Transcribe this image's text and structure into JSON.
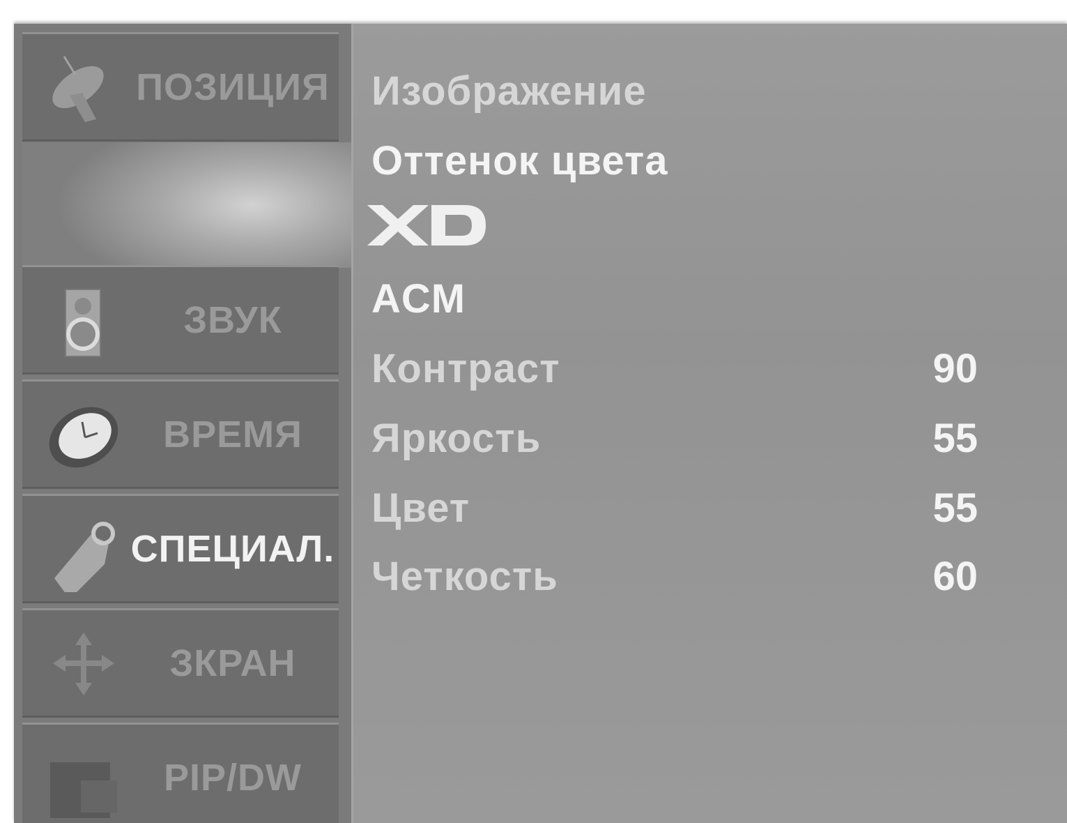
{
  "sidebar": {
    "items": [
      {
        "label": "ПОЗИЦИЯ",
        "icon": "satellite-dish-icon"
      },
      {
        "label": "ЗВУК",
        "icon": "speaker-icon"
      },
      {
        "label": "ВРЕМЯ",
        "icon": "clock-icon"
      },
      {
        "label": "СПЕЦИАЛ.",
        "icon": "tag-icon"
      },
      {
        "label": "ЗКРАН",
        "icon": "move-arrows-icon"
      },
      {
        "label": "PIP/DW",
        "icon": "pip-window-icon"
      }
    ]
  },
  "menu": {
    "items": [
      {
        "label": "Изображение"
      },
      {
        "label": "Оттенок цвета"
      },
      {
        "label": "XD",
        "icon": "xd-logo"
      },
      {
        "label": "ACM"
      },
      {
        "label": "Контраст",
        "value": "90"
      },
      {
        "label": "Яркость",
        "value": "55"
      },
      {
        "label": "Цвет",
        "value": "55"
      },
      {
        "label": "Четкость",
        "value": "60"
      }
    ]
  },
  "colors": {
    "panel": "#8f8f8f",
    "sidebar": "#7b7b7b",
    "highlight_text": "#f2f2f2",
    "dim_text": "#9a9a9a"
  }
}
